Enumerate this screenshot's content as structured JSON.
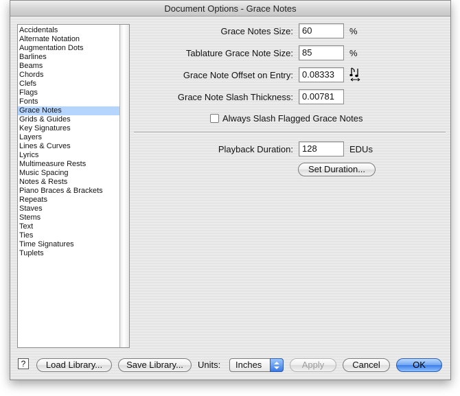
{
  "window": {
    "title": "Document Options - Grace Notes"
  },
  "sidebar": {
    "selected": "Grace Notes",
    "items": [
      "Accidentals",
      "Alternate Notation",
      "Augmentation Dots",
      "Barlines",
      "Beams",
      "Chords",
      "Clefs",
      "Flags",
      "Fonts",
      "Grace Notes",
      "Grids & Guides",
      "Key Signatures",
      "Layers",
      "Lines & Curves",
      "Lyrics",
      "Multimeasure Rests",
      "Music Spacing",
      "Notes & Rests",
      "Piano Braces & Brackets",
      "Repeats",
      "Staves",
      "Stems",
      "Text",
      "Ties",
      "Time Signatures",
      "Tuplets"
    ]
  },
  "settings": {
    "grace_notes_size": {
      "label": "Grace Notes Size:",
      "value": "60",
      "unit": "%"
    },
    "tab_grace_note_size": {
      "label": "Tablature Grace Note Size:",
      "value": "85",
      "unit": "%"
    },
    "offset_on_entry": {
      "label": "Grace Note Offset on Entry:",
      "value": "0.08333",
      "icon": "note-offset-icon"
    },
    "slash_thickness": {
      "label": "Grace Note Slash Thickness:",
      "value": "0.00781"
    },
    "always_slash": {
      "label": "Always Slash Flagged Grace Notes",
      "checked": false
    },
    "playback_duration": {
      "label": "Playback Duration:",
      "value": "128",
      "unit": "EDUs"
    },
    "set_duration_button": "Set Duration..."
  },
  "footer": {
    "help_label": "?",
    "load_library": "Load Library...",
    "save_library": "Save Library...",
    "units_label": "Units:",
    "units_value": "Inches",
    "apply": "Apply",
    "cancel": "Cancel",
    "ok": "OK"
  },
  "colors": {
    "selection": "#b5d5ff",
    "default_button": "#3c7de8"
  }
}
